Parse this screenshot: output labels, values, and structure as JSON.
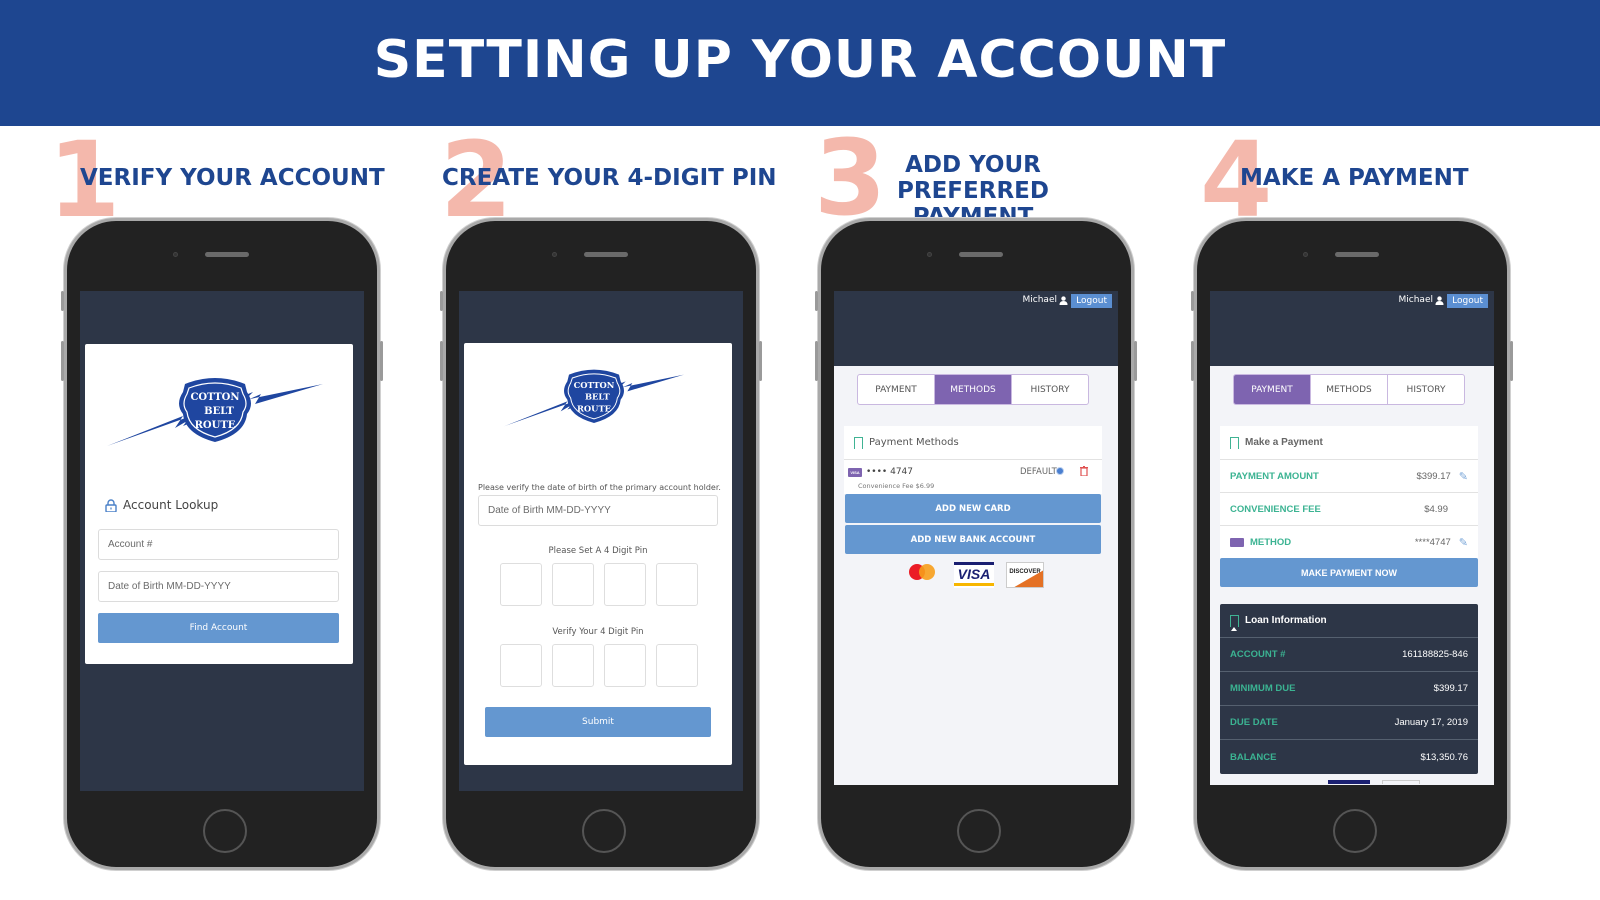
{
  "banner": {
    "title": "SETTING UP YOUR ACCOUNT"
  },
  "steps": [
    {
      "number": "1",
      "title": "VERIFY YOUR ACCOUNT"
    },
    {
      "number": "2",
      "title": "CREATE YOUR 4-DIGIT PIN"
    },
    {
      "number": "3",
      "title_line1": "ADD YOUR PREFERRED",
      "title_line2": "PAYMENT"
    },
    {
      "number": "4",
      "title": "MAKE A PAYMENT"
    }
  ],
  "brand": {
    "logo_text": [
      "COTTON",
      "BELT",
      "ROUTE"
    ],
    "color": "#1f46a0"
  },
  "screen1": {
    "heading": "Account Lookup",
    "account_placeholder": "Account #",
    "dob_placeholder": "Date of Birth MM-DD-YYYY",
    "button": "Find Account"
  },
  "screen2": {
    "instruction": "Please verify the date of birth of the primary account holder.",
    "dob_placeholder": "Date of Birth MM-DD-YYYY",
    "set_pin_label": "Please Set A 4 Digit Pin",
    "verify_pin_label": "Verify Your 4 Digit Pin",
    "button": "Submit"
  },
  "screen3": {
    "user": "Michael",
    "logout": "Logout",
    "tabs": [
      "PAYMENT",
      "METHODS",
      "HISTORY"
    ],
    "active_tab": "METHODS",
    "panel_title": "Payment Methods",
    "card": {
      "brand": "VISA",
      "masked": "•••• 4747",
      "default_label": "DEFAULT",
      "fee": "Convenience Fee $6.99"
    },
    "add_card": "ADD NEW CARD",
    "add_bank": "ADD NEW BANK ACCOUNT",
    "card_logos": [
      "mastercard",
      "VISA",
      "DISCOVER"
    ]
  },
  "screen4": {
    "user": "Michael",
    "logout": "Logout",
    "tabs": [
      "PAYMENT",
      "METHODS",
      "HISTORY"
    ],
    "active_tab": "PAYMENT",
    "panel_title": "Make a Payment",
    "rows": [
      {
        "label": "PAYMENT AMOUNT",
        "value": "$399.17"
      },
      {
        "label": "CONVENIENCE FEE",
        "value": "$4.99"
      },
      {
        "label": "METHOD",
        "value": "****4747"
      }
    ],
    "button": "MAKE PAYMENT NOW",
    "loan_title": "Loan Information",
    "loan_rows": [
      {
        "label": "ACCOUNT #",
        "value": "161188825-846"
      },
      {
        "label": "MINIMUM DUE",
        "value": "$399.17"
      },
      {
        "label": "DUE DATE",
        "value": "January 17, 2019"
      },
      {
        "label": "BALANCE",
        "value": "$13,350.76"
      }
    ]
  }
}
